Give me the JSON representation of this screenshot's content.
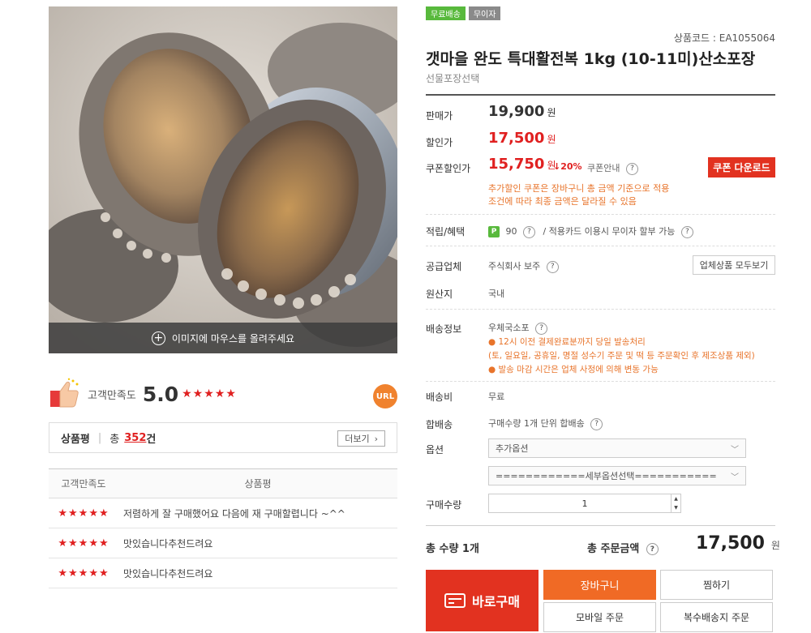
{
  "gallery": {
    "hover_hint": "이미지에 마우스를 올려주세요",
    "image_description": "abalone product photo"
  },
  "satisfaction": {
    "label": "고객만족도",
    "score": "5.0",
    "stars": "★★★★★",
    "url_badge": "URL"
  },
  "reviews": {
    "title": "상품평",
    "total_label": "총",
    "count": "352",
    "count_unit": "건",
    "more_label": "더보기",
    "col_rating": "고객만족도",
    "col_review": "상품평",
    "rows": [
      {
        "stars": "★★★★★",
        "text": "저렴하게 잘 구매했어요 다음에 재 구매할렵니다 ~^^"
      },
      {
        "stars": "★★★★★",
        "text": "맛있습니다추천드려요"
      },
      {
        "stars": "★★★★★",
        "text": "맛있습니다추천드려요"
      }
    ]
  },
  "product": {
    "badges": [
      "무료배송",
      "무이자"
    ],
    "code": "상품코드 : EA1055064",
    "title": "갯마을 완도 특대활전복 1kg (10-11미)산소포장",
    "subtitle": "선물포장선택"
  },
  "prices": {
    "label_original": "판매가",
    "original": "19,900",
    "label_discount": "할인가",
    "discount": "17,500",
    "label_coupon": "쿠폰할인가",
    "coupon": "15,750",
    "won": "원",
    "rate": "↓20%",
    "coupon_info": "쿠폰안내",
    "coupon_button": "쿠폰 다운로드",
    "coupon_note_1": "추가할인 쿠폰은 장바구니 총 금액 기준으로 적용",
    "coupon_note_2": "조건에 따라 최종 금액은 달라질 수 있음"
  },
  "info": {
    "benefit_label": "적립/혜택",
    "points": "90",
    "benefit_extra": "/  적용카드 이용시 무이자 할부 가능",
    "supplier_label": "공급업체",
    "supplier": "주식회사 보주",
    "supplier_button": "업체상품 모두보기",
    "origin_label": "원산지",
    "origin": "국내",
    "shipping_label": "배송정보",
    "shipping": "우체국소포",
    "ship_note_1": "● 12시 이전 결제완료분까지 당일 발송처리",
    "ship_note_2": "(토, 일요일, 공휴일, 명절 성수기 주문 및 떡 등 주문확인 후 제조상품 제외)",
    "ship_note_3": "● 발송 마감 시간은 업체 사정에 의해 변동 가능",
    "fee_label": "배송비",
    "fee": "무료",
    "combine_label": "합배송",
    "combine": "구매수량 1개 단위 합배송",
    "option_label": "옵션",
    "option_1": "추가옵션",
    "option_2": "============세부옵션선택===========",
    "qty_label": "구매수량",
    "qty": "1"
  },
  "totals": {
    "qty_label": "총 수량 1개",
    "amount_label": "총 주문금액",
    "amount": "17,500",
    "won": "원"
  },
  "actions": {
    "buy_now": "바로구매",
    "cart": "장바구니",
    "wishlist": "찜하기",
    "mobile_order": "모바일 주문",
    "multi_ship": "복수배송지 주문"
  },
  "colors": {
    "accent_red": "#e23220",
    "orange": "#f06a25",
    "green_badge": "#58b93c"
  }
}
